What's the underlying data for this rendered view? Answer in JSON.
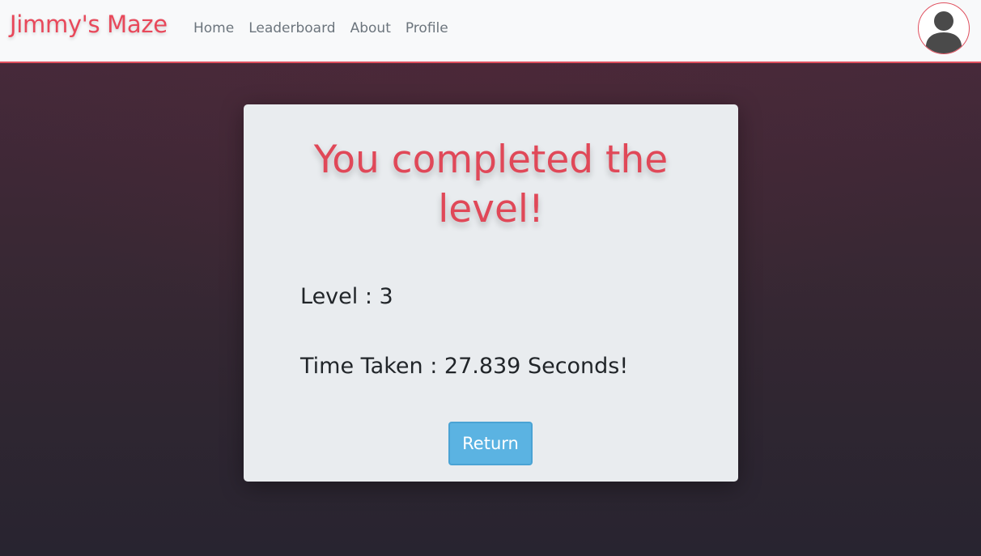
{
  "navbar": {
    "brand": "Jimmy's Maze",
    "links": [
      {
        "label": "Home"
      },
      {
        "label": "Leaderboard"
      },
      {
        "label": "About"
      },
      {
        "label": "Profile"
      }
    ],
    "avatar_icon": "user-silhouette-icon"
  },
  "result": {
    "headline": "You completed the level!",
    "level_text": "Level : 3",
    "time_text": "Time Taken : 27.839 Seconds!",
    "return_label": "Return"
  },
  "colors": {
    "brand": "#e8485a",
    "accent_border": "#e0505f",
    "button": "#5bb3e2",
    "card": "#e9ecef",
    "navbar": "#f8f9fa"
  }
}
